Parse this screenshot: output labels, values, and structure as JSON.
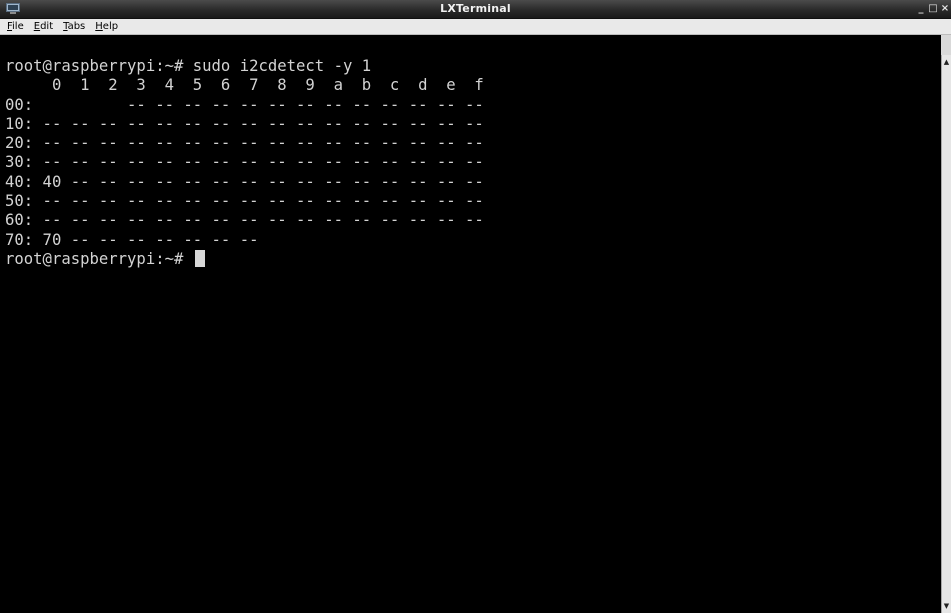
{
  "window": {
    "title": "LXTerminal",
    "controls": {
      "minimize": "_",
      "maximize": "□",
      "close": "×"
    }
  },
  "menu": {
    "items": [
      {
        "mnemonic": "F",
        "rest": "ile"
      },
      {
        "mnemonic": "E",
        "rest": "dit"
      },
      {
        "mnemonic": "T",
        "rest": "abs"
      },
      {
        "mnemonic": "H",
        "rest": "elp"
      }
    ]
  },
  "terminal": {
    "lines": [
      "root@raspberrypi:~# sudo i2cdetect -y 1",
      "     0  1  2  3  4  5  6  7  8  9  a  b  c  d  e  f",
      "00:          -- -- -- -- -- -- -- -- -- -- -- -- --",
      "10: -- -- -- -- -- -- -- -- -- -- -- -- -- -- -- --",
      "20: -- -- -- -- -- -- -- -- -- -- -- -- -- -- -- --",
      "30: -- -- -- -- -- -- -- -- -- -- -- -- -- -- -- --",
      "40: 40 -- -- -- -- -- -- -- -- -- -- -- -- -- -- --",
      "50: -- -- -- -- -- -- -- -- -- -- -- -- -- -- -- --",
      "60: -- -- -- -- -- -- -- -- -- -- -- -- -- -- -- --",
      "70: 70 -- -- -- -- -- -- --"
    ],
    "prompt": "root@raspberrypi:~# "
  },
  "scrollbar": {
    "up_arrow": "▲",
    "down_arrow": "▼"
  },
  "colors": {
    "terminal_bg": "#000000",
    "terminal_fg": "#d3d3d3",
    "titlebar_bg": "#2a2a2a",
    "menubar_bg": "#e9e9e9"
  },
  "icons": {
    "app": "terminal-app-icon",
    "minimize": "minimize-icon",
    "maximize": "maximize-icon",
    "close": "close-icon",
    "scroll_up": "scroll-up-arrow-icon",
    "scroll_down": "scroll-down-arrow-icon"
  }
}
